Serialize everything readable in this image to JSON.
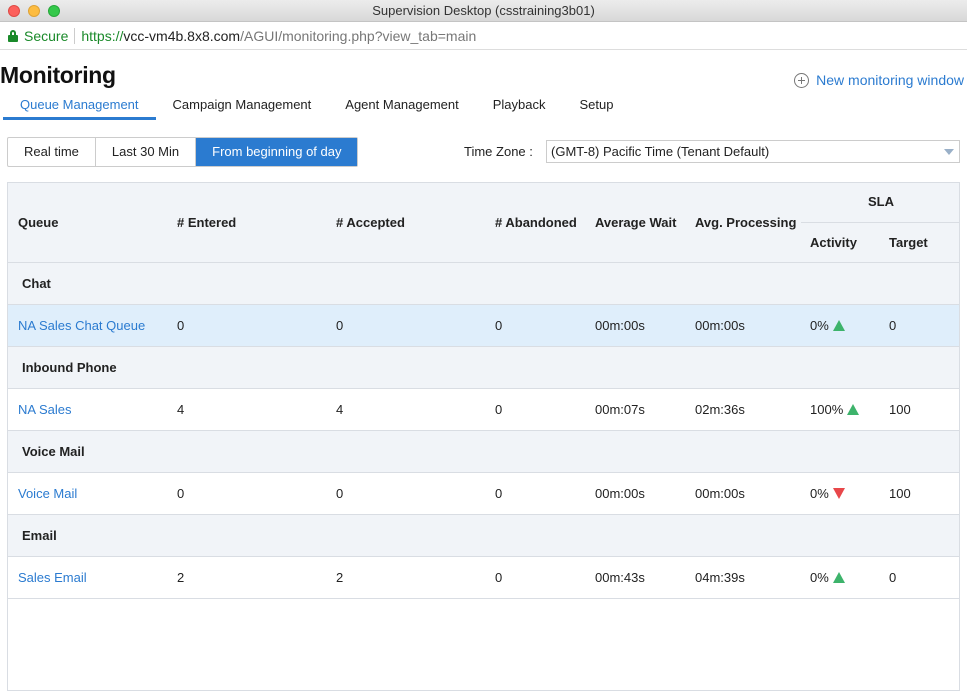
{
  "window": {
    "title": "Supervision Desktop (csstraining3b01)"
  },
  "address_bar": {
    "secure_label": "Secure",
    "scheme": "https://",
    "host": "vcc-vm4b.8x8.com",
    "path": "/AGUI/monitoring.php?view_tab=main"
  },
  "header": {
    "title": "Monitoring",
    "new_window_label": "New monitoring window"
  },
  "tabs": [
    {
      "label": "Queue Management",
      "active": true
    },
    {
      "label": "Campaign Management",
      "active": false
    },
    {
      "label": "Agent Management",
      "active": false
    },
    {
      "label": "Playback",
      "active": false
    },
    {
      "label": "Setup",
      "active": false
    }
  ],
  "range_filter": {
    "options": [
      "Real time",
      "Last 30 Min",
      "From beginning of day"
    ],
    "selected": "From beginning of day"
  },
  "timezone": {
    "label": "Time Zone :",
    "value": "(GMT-8) Pacific Time (Tenant Default)"
  },
  "table": {
    "columns": {
      "queue": "Queue",
      "entered": "# Entered",
      "accepted": "# Accepted",
      "abandoned": "# Abandoned",
      "avg_wait": "Average Wait",
      "avg_processing": "Avg. Processing",
      "sla": "SLA",
      "sla_activity": "Activity",
      "sla_target": "Target"
    },
    "groups": [
      {
        "name": "Chat",
        "rows": [
          {
            "queue": "NA Sales Chat Queue",
            "entered": "0",
            "accepted": "0",
            "abandoned": "0",
            "avg_wait": "00m:00s",
            "avg_processing": "00m:00s",
            "sla_activity": "0%",
            "trend": "up",
            "sla_target": "0",
            "selected": true
          }
        ]
      },
      {
        "name": "Inbound Phone",
        "rows": [
          {
            "queue": "NA Sales",
            "entered": "4",
            "accepted": "4",
            "abandoned": "0",
            "avg_wait": "00m:07s",
            "avg_processing": "02m:36s",
            "sla_activity": "100%",
            "trend": "up",
            "sla_target": "100"
          }
        ]
      },
      {
        "name": "Voice Mail",
        "rows": [
          {
            "queue": "Voice Mail",
            "entered": "0",
            "accepted": "0",
            "abandoned": "0",
            "avg_wait": "00m:00s",
            "avg_processing": "00m:00s",
            "sla_activity": "0%",
            "trend": "down",
            "sla_target": "100"
          }
        ]
      },
      {
        "name": "Email",
        "rows": [
          {
            "queue": "Sales Email",
            "entered": "2",
            "accepted": "2",
            "abandoned": "0",
            "avg_wait": "00m:43s",
            "avg_processing": "04m:39s",
            "sla_activity": "0%",
            "trend": "up",
            "sla_target": "0"
          }
        ]
      }
    ]
  },
  "colors": {
    "accent": "#2b7bd0",
    "trend_up": "#3db36b",
    "trend_down": "#e8474a",
    "header_bg": "#f1f4f8",
    "selected_row": "#dfeefb"
  }
}
